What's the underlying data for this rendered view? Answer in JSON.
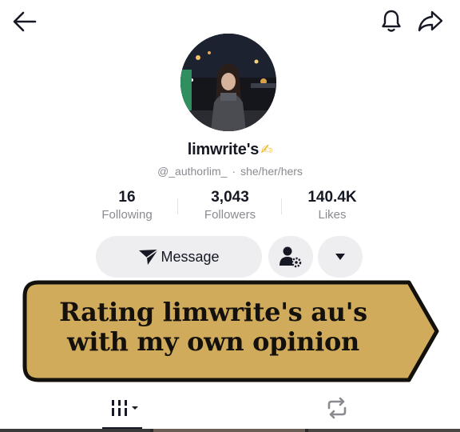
{
  "header": {
    "back_icon": "arrow-left-icon",
    "bell_icon": "bell-icon",
    "share_icon": "share-icon"
  },
  "profile": {
    "display_name": "limwrite's",
    "name_emoji": "✍",
    "handle": "@_authorlim_",
    "separator": "·",
    "pronouns": "she/her/hers"
  },
  "stats": {
    "following": {
      "value": "16",
      "label": "Following"
    },
    "followers": {
      "value": "3,043",
      "label": "Followers"
    },
    "likes": {
      "value": "140.4K",
      "label": "Likes"
    }
  },
  "actions": {
    "message_label": "Message",
    "add_friend_icon": "person-gear-icon",
    "dropdown_icon": "caret-down-icon"
  },
  "banner": {
    "line1": "Rating limwrite's au's",
    "line2": "with my own opinion",
    "fill_color": "#d0ab5b",
    "border_color": "#14110d"
  },
  "tabs": {
    "videos_icon": "grid-bars-icon",
    "reposts_icon": "repost-icon"
  }
}
